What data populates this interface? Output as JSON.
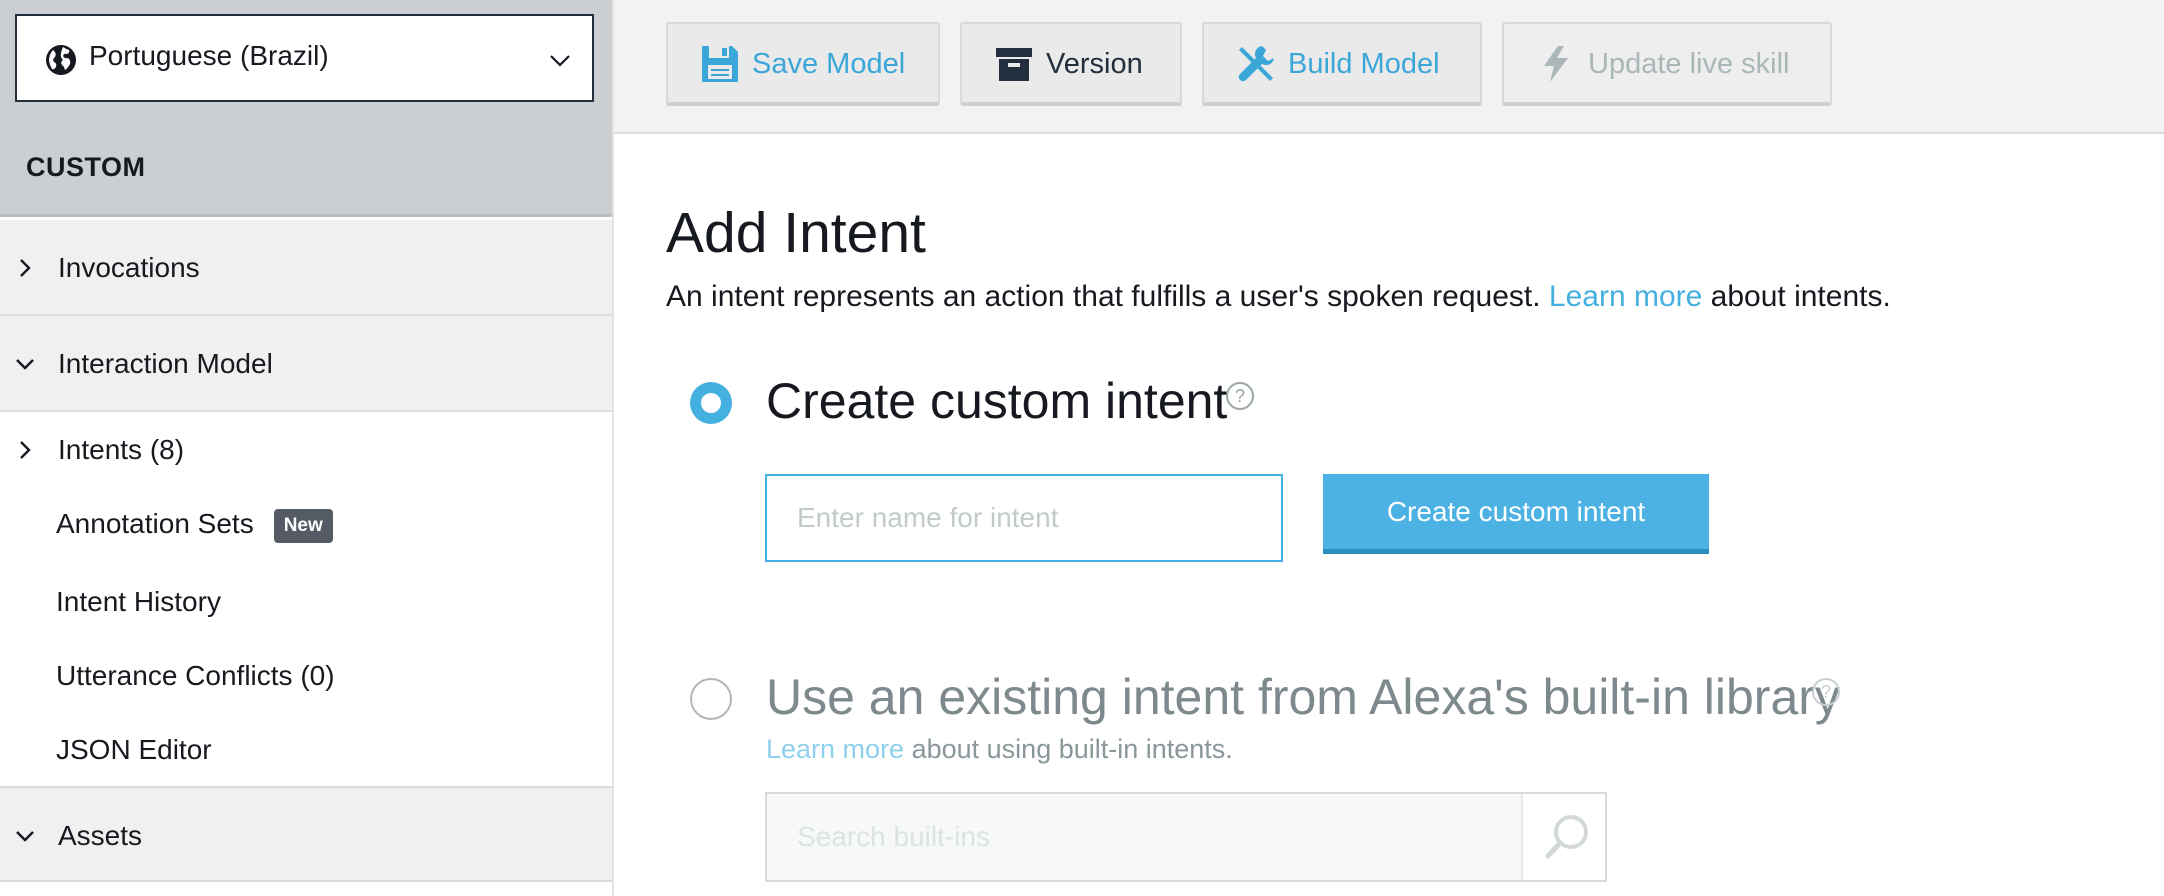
{
  "sidebar": {
    "language": "Portuguese (Brazil)",
    "section_label": "CUSTOM",
    "groups": [
      {
        "label": "Invocations"
      },
      {
        "label": "Interaction Model"
      }
    ],
    "items": [
      {
        "label": "Intents (8)"
      },
      {
        "label": "Annotation Sets",
        "badge": "New"
      },
      {
        "label": "Intent History"
      },
      {
        "label": "Utterance Conflicts (0)"
      },
      {
        "label": "JSON Editor"
      }
    ],
    "assets_label": "Assets"
  },
  "toolbar": {
    "save": "Save Model",
    "version": "Version",
    "build": "Build Model",
    "update": "Update live skill"
  },
  "main": {
    "title": "Add Intent",
    "description_pre": "An intent represents an action that fulfills a user's spoken request.",
    "description_link": "Learn more",
    "description_post": "about intents.",
    "custom_option_title": "Create custom intent",
    "intent_name_placeholder": "Enter name for intent",
    "create_button": "Create custom intent",
    "builtin_option_title": "Use an existing intent from Alexa's built-in library",
    "builtin_link": "Learn more",
    "builtin_post": "about using built-in intents.",
    "search_placeholder": "Search built-ins",
    "help_glyph": "?"
  },
  "colors": {
    "accent": "#44b0e0",
    "sidebar_header": "#cbcfd1",
    "group_bg": "#f0f0f0",
    "text": "#16191f"
  }
}
